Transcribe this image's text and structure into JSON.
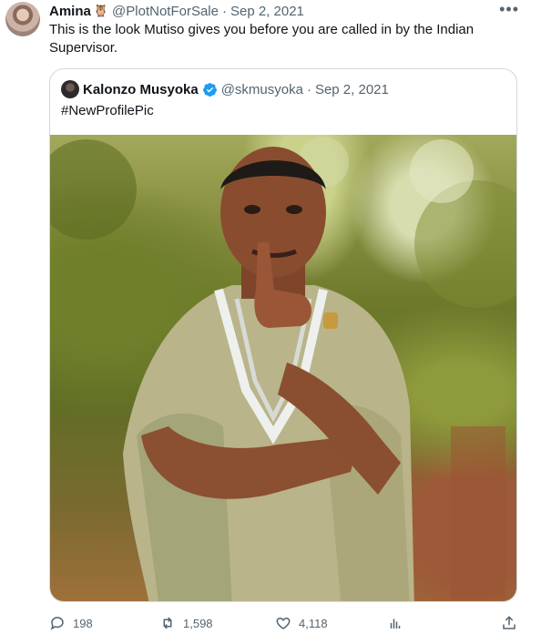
{
  "tweet": {
    "author_name": "Amina",
    "author_handle": "@PlotNotForSale",
    "separator": "·",
    "date": "Sep 2, 2021",
    "text": "This is the look Mutiso gives you before you are called in by the Indian Supervisor.",
    "more_icon": "more-horizontal-icon"
  },
  "quoted": {
    "author_name": "Kalonzo Musyoka",
    "author_handle": "@skmusyoka",
    "separator": "·",
    "date": "Sep 2, 2021",
    "text": "#NewProfilePic"
  },
  "actions": {
    "replies": "198",
    "retweets": "1,598",
    "likes": "4,118"
  },
  "colors": {
    "text": "#0f1419",
    "muted": "#536471",
    "verified": "#1d9bf0",
    "border": "#cfd9de"
  }
}
